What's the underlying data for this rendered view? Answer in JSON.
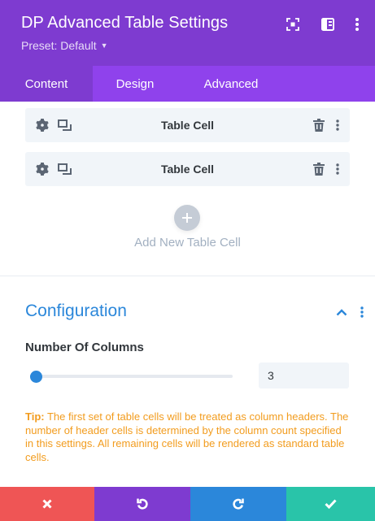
{
  "header": {
    "title": "DP Advanced Table Settings",
    "preset_label": "Preset: Default",
    "icons": [
      "focus-mode-icon",
      "split-view-icon",
      "more-options-icon"
    ],
    "bg_color": "#7e3bd0"
  },
  "tabs": [
    {
      "label": "Content",
      "active": true
    },
    {
      "label": "Design",
      "active": false
    },
    {
      "label": "Advanced",
      "active": false
    }
  ],
  "cells": {
    "items": [
      {
        "label": "Table Cell"
      },
      {
        "label": "Table Cell"
      }
    ],
    "add_label": "Add New Table Cell"
  },
  "configuration": {
    "title": "Configuration",
    "columns_label": "Number Of Columns",
    "columns_value": "3",
    "slider_fraction": 0.03,
    "tip_prefix": "Tip:",
    "tip_text": " The first set of table cells will be treated as column headers. The number of header cells is determined by the column count specified in this settings. All remaining cells will be rendered as standard table cells."
  },
  "footer": {
    "buttons": [
      {
        "name": "discard",
        "icon": "close-icon",
        "color": "#ef5555"
      },
      {
        "name": "undo",
        "icon": "undo-icon",
        "color": "#7e3bd0"
      },
      {
        "name": "redo",
        "icon": "redo-icon",
        "color": "#2b87da"
      },
      {
        "name": "save",
        "icon": "check-icon",
        "color": "#29c4a9"
      }
    ]
  },
  "colors": {
    "accent_blue": "#2b87da",
    "tip_orange": "#f29c1e",
    "tab_bar": "#8f42ec"
  }
}
